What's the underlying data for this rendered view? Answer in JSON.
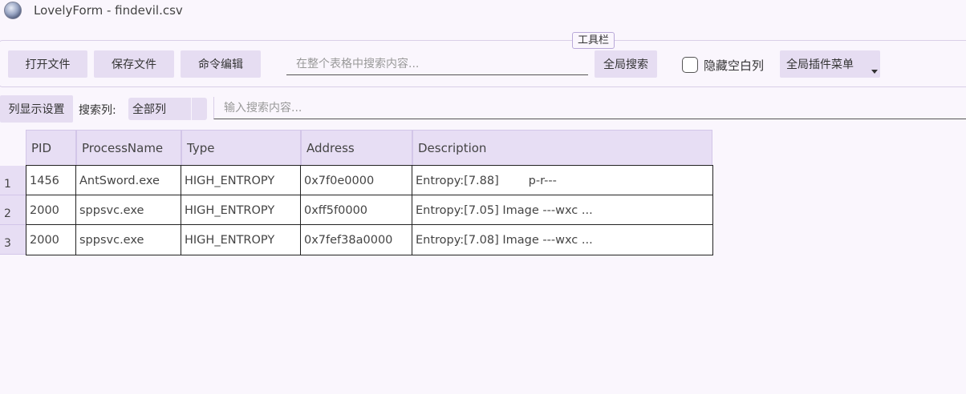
{
  "window": {
    "title": "LovelyForm - findevil.csv",
    "icon": "app-avatar-icon"
  },
  "toolbar": {
    "caption": "工具栏",
    "open_file": "打开文件",
    "save_file": "保存文件",
    "command_edit": "命令编辑",
    "global_search_placeholder": "在整个表格中搜索内容...",
    "global_search_value": "",
    "global_search_button": "全局搜索",
    "hide_empty_columns_label": "隐藏空白列",
    "hide_empty_columns_checked": false,
    "plugin_menu": "全局插件菜单"
  },
  "filterbar": {
    "column_display_settings": "列显示设置",
    "search_column_label": "搜索列:",
    "search_column_value": "全部列",
    "search_placeholder": "输入搜索内容...",
    "search_value": ""
  },
  "table": {
    "columns": [
      "PID",
      "ProcessName",
      "Type",
      "Address",
      "Description"
    ],
    "row_numbers": [
      "1",
      "2",
      "3"
    ],
    "rows": [
      [
        "1456",
        "AntSword.exe",
        "HIGH_ENTROPY",
        "0x7f0e0000",
        "Entropy:[7.88]        p-r---"
      ],
      [
        "2000",
        "sppsvc.exe",
        "HIGH_ENTROPY",
        "0xff5f0000",
        "Entropy:[7.05] Image ---wxc ..."
      ],
      [
        "2000",
        "sppsvc.exe",
        "HIGH_ENTROPY",
        "0x7fef38a0000",
        "Entropy:[7.08] Image ---wxc ..."
      ]
    ]
  },
  "colors": {
    "background": "#faf6fd",
    "button": "#e6ddf2",
    "header": "#e7def4",
    "grid_border": "#222222"
  }
}
